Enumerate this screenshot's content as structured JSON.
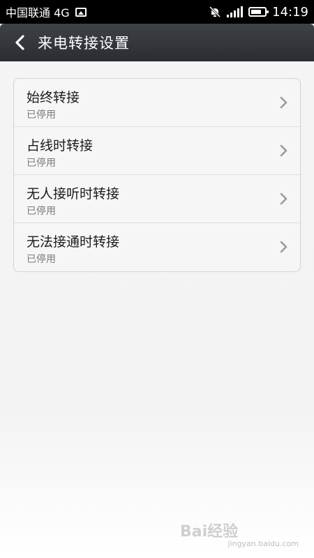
{
  "status_bar": {
    "carrier": "中国联通 4G",
    "time": "14:19",
    "battery_level": 0.8,
    "signal_bars": 4
  },
  "header": {
    "title": "来电转接设置"
  },
  "settings": {
    "items": [
      {
        "title": "始终转接",
        "status": "已停用"
      },
      {
        "title": "占线时转接",
        "status": "已停用"
      },
      {
        "title": "无人接听时转接",
        "status": "已停用"
      },
      {
        "title": "无法接通时转接",
        "status": "已停用"
      }
    ]
  },
  "watermark": {
    "logo_text": "Bai经验",
    "url": "jingyan.baidu.com"
  },
  "colors": {
    "status_bar_bg": "#000000",
    "title_bar_bg": "#2f3237",
    "content_bg": "#f3f3f3"
  }
}
